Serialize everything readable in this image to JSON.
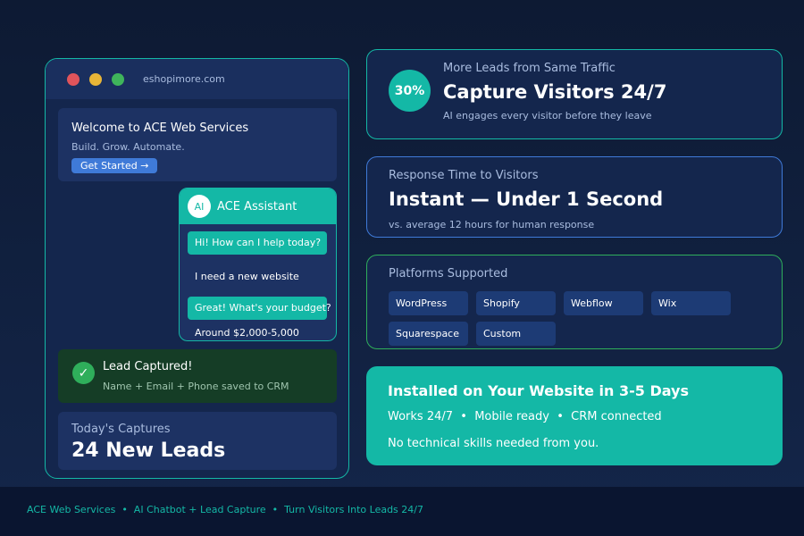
{
  "browser": {
    "url": "eshopimore.com",
    "welcome": {
      "title": "Welcome to ACE Web Services",
      "subtitle": "Build. Grow. Automate.",
      "cta": "Get Started →"
    },
    "chat": {
      "badge": "AI",
      "name": "ACE Assistant",
      "messages": [
        {
          "from": "bot",
          "text": "Hi! How can I help today?"
        },
        {
          "from": "user",
          "text": "I need a new website"
        },
        {
          "from": "bot",
          "text": "Great! What's your budget?"
        },
        {
          "from": "user",
          "text": "Around $2,000-5,000"
        }
      ]
    },
    "lead": {
      "title": "Lead Captured!",
      "subtitle": "Name + Email + Phone saved to CRM"
    },
    "captures": {
      "label": "Today's Captures",
      "value": "24 New Leads"
    }
  },
  "cards": {
    "traffic": {
      "percent": "30%",
      "label": "More Leads from Same Traffic",
      "title": "Capture Visitors 24/7",
      "subtitle": "AI engages every visitor before they leave"
    },
    "response": {
      "label": "Response Time to Visitors",
      "title": "Instant — Under 1 Second",
      "subtitle": "vs. average 12 hours for human response"
    },
    "platforms": {
      "label": "Platforms Supported",
      "items": [
        "WordPress",
        "Shopify",
        "Webflow",
        "Wix",
        "Squarespace",
        "Custom"
      ]
    },
    "install": {
      "title": "Installed on Your Website in 3-5 Days",
      "features": "Works 24/7  •  Mobile ready  •  CRM connected",
      "note": "No technical skills needed from you."
    }
  },
  "footer": {
    "text": "ACE Web Services  •  AI Chatbot + Lead Capture  •  Turn Visitors Into Leads 24/7"
  },
  "colors": {
    "accent": "#14b8a6",
    "blue": "#3f7ad8",
    "green": "#2fae5b",
    "background": "#0d1a33"
  }
}
